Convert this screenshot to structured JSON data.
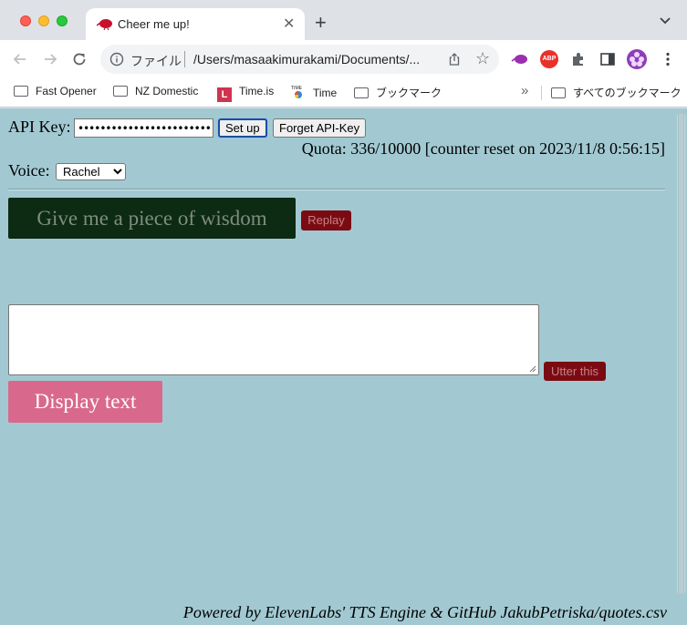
{
  "tab": {
    "title": "Cheer me up!",
    "favicon": "kiwi-bird-icon"
  },
  "omnibox": {
    "scheme_label": "ファイル",
    "url": "/Users/masaakimurakami/Documents/..."
  },
  "bookmarks": {
    "items": [
      {
        "label": "Fast Opener",
        "icon": "folder-icon"
      },
      {
        "label": "NZ Domestic",
        "icon": "folder-icon"
      },
      {
        "label": "Time.is",
        "icon": "time-is-icon"
      },
      {
        "label": "Time",
        "icon": "time-icon"
      },
      {
        "label": "ブックマーク",
        "icon": "folder-icon"
      }
    ],
    "overflow_label": "»",
    "all_bookmarks": "すべてのブックマーク"
  },
  "page": {
    "api_label": "API Key:",
    "api_value": "••••••••••••••••••••••••••••••••",
    "setup_label": "Set up",
    "forget_label": "Forget API-Key",
    "quota_text": "Quota: 336/10000 [counter reset on 2023/11/8 0:56:15]",
    "voice_label": "Voice:",
    "voice_selected": "Rachel",
    "wisdom_label": "Give me a piece of wisdom",
    "replay_label": "Replay",
    "textarea_value": "",
    "utter_label": "Utter this",
    "display_label": "Display text",
    "footer_text": "Powered by ElevenLabs' TTS Engine & GitHub JakubPetriska/quotes.csv"
  },
  "colors": {
    "page_bg": "#a2c9d2",
    "wisdom_bg": "#0d2a12",
    "replay_bg": "#7b0b12",
    "display_bg": "#d9698c"
  }
}
